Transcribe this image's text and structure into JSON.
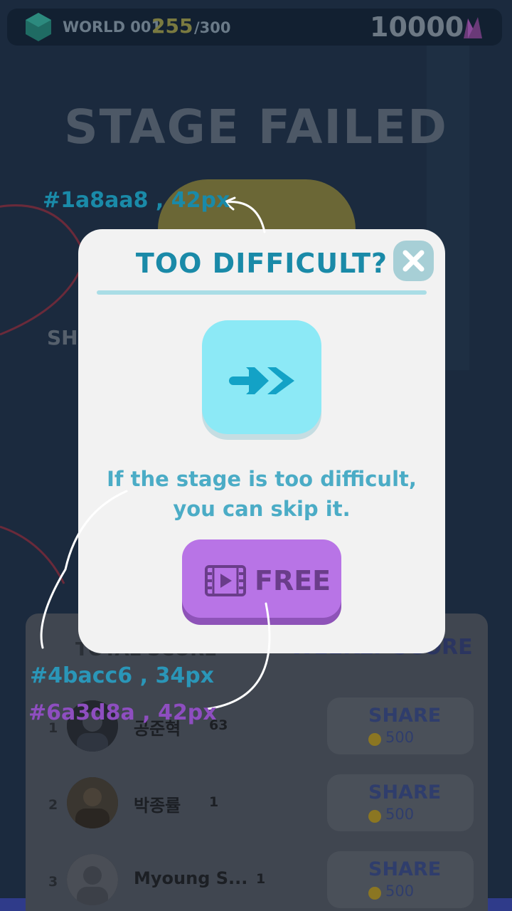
{
  "top_bar": {
    "world_label": "WORLD 001",
    "progress_current": "255",
    "progress_total": "/300",
    "coins": "10000",
    "left_icon": "green-gem-icon",
    "right_icon": "purple-crystal-icon"
  },
  "background": {
    "title": "STAGE FAILED",
    "share_label": "SHAR",
    "stage_label": "GE"
  },
  "modal": {
    "title": "TOO DIFFICULT?",
    "close_icon": "close-icon",
    "skip_icon": "fast-forward-arrows-icon",
    "message_line1": "If the stage is too difficult,",
    "message_line2": "you can skip it.",
    "free_button_label": "FREE",
    "free_button_icon": "video-film-icon",
    "colors": {
      "title": "#1a8aa8",
      "message": "#4bacc6",
      "free_label": "#6a3d8a"
    }
  },
  "leaderboard": {
    "header_left": "TOTAL SCORE",
    "header_right": "WEEKLY SCORE",
    "rows": [
      {
        "rank": "1",
        "name": "공준혁",
        "score": "63",
        "share_label": "SHARE",
        "reward": "500"
      },
      {
        "rank": "2",
        "name": "박종률",
        "score": "1",
        "share_label": "SHARE",
        "reward": "500"
      },
      {
        "rank": "3",
        "name": "Myoung S...",
        "score": "1",
        "share_label": "SHARE",
        "reward": "500"
      }
    ]
  },
  "annotations": {
    "title_spec": "#1a8aa8 , 42px",
    "message_spec": "#4bacc6 , 34px",
    "button_spec": "#6a3d8a , 42px"
  }
}
